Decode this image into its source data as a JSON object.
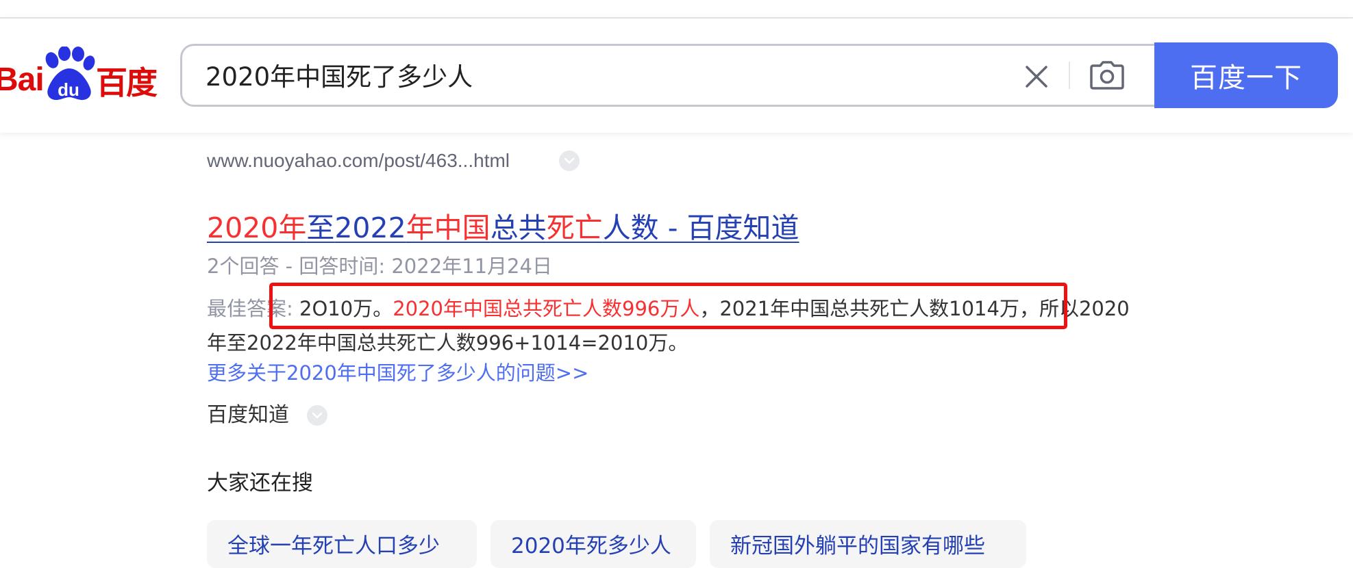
{
  "header": {
    "logo": {
      "latin": "Bai",
      "paw_text": "du",
      "chinese": "百度"
    },
    "search": {
      "query": "2020年中国死了多少人",
      "button_label": "百度一下"
    }
  },
  "result": {
    "url": "www.nuoyahao.com/post/463...html",
    "title": {
      "p1": "2020年",
      "p2": "至",
      "p3": "2022",
      "p4": "年中国",
      "p5": "总共",
      "p6": "死亡",
      "p7": "人数 - 百度知道"
    },
    "meta": "2个回答 - 回答时间: 2022年11月24日",
    "answer": {
      "label": "最佳答案: ",
      "a1": "2O10万。",
      "highlight": "2020年中国总共死亡人数996万人",
      "a2": "，2021年中国总共死亡人数1014万，所以2020年至2022年中国总共死亡人数996+1014=2010万。"
    },
    "more_link": "更多关于2020年中国死了多少人的问题>>",
    "source": "百度知道"
  },
  "related": {
    "title": "大家还在搜",
    "items": [
      "全球一年死亡人口多少",
      "2020年死多少人",
      "新冠国外躺平的国家有哪些"
    ]
  },
  "colors": {
    "brand_blue": "#4e6ef2",
    "title_blue": "#2440b3",
    "highlight_red": "#f73131",
    "annotation_red": "#ee1111",
    "logo_red": "#de0b0b",
    "logo_blue": "#2932e1"
  },
  "icons": {
    "clear": "close-icon",
    "camera": "camera-icon",
    "dropdown": "chevron-down-icon"
  }
}
